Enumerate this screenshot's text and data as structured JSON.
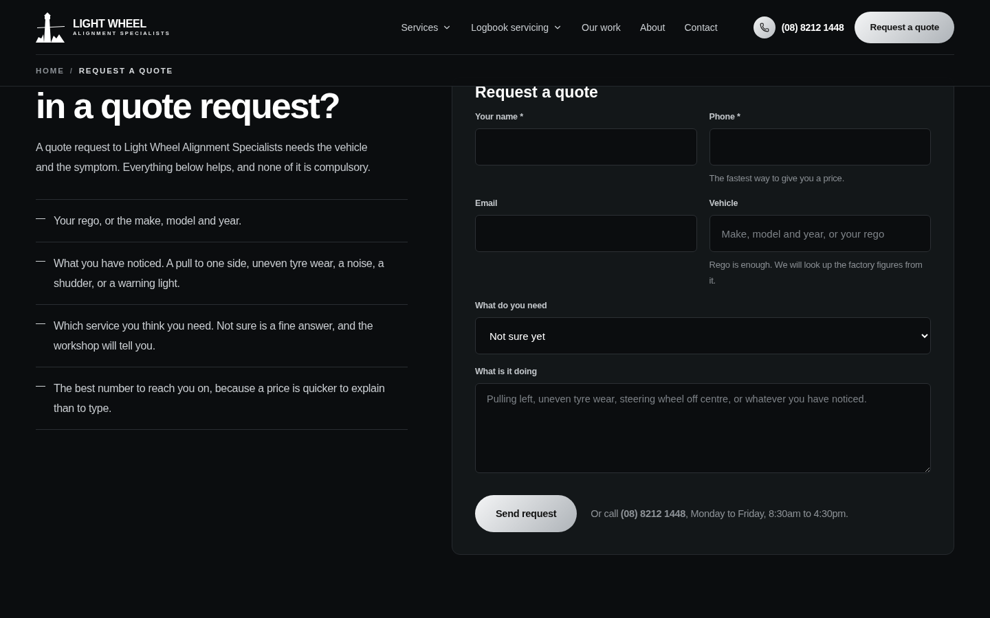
{
  "header": {
    "brand": "LIGHT WHEEL",
    "tagline": "ALIGNMENT SPECIALISTS",
    "nav": [
      {
        "label": "Services",
        "dropdown": true
      },
      {
        "label": "Logbook servicing",
        "dropdown": true
      },
      {
        "label": "Our work",
        "dropdown": false
      },
      {
        "label": "About",
        "dropdown": false
      },
      {
        "label": "Contact",
        "dropdown": false
      }
    ],
    "phone": "(08) 8212 1448",
    "cta": "Request a quote"
  },
  "breadcrumb": [
    {
      "label": "HOME",
      "current": false
    },
    {
      "label": "REQUEST A QUOTE",
      "current": true
    }
  ],
  "breadcrumb_separator": "/",
  "intro": {
    "heading": "in a quote request?",
    "paragraph": "A quote request to Light Wheel Alignment Specialists needs the vehicle and the symptom. Everything below helps, and none of it is compulsory.",
    "points": [
      "Your rego, or the make, model and year.",
      "What you have noticed. A pull to one side, uneven tyre wear, a noise, a shudder, or a warning light.",
      "Which service you think you need. Not sure is a fine answer, and the workshop will tell you.",
      "The best number to reach you on, because a price is quicker to explain than to type."
    ]
  },
  "form": {
    "title": "Request a quote",
    "fields": [
      {
        "kind": "input",
        "label": "Your name *"
      },
      {
        "kind": "input",
        "label": "Phone *",
        "hint": "The fastest way to give you a price."
      },
      {
        "kind": "input",
        "label": "Email"
      },
      {
        "kind": "input",
        "label": "Vehicle",
        "placeholder": "Make, model and year, or your rego",
        "hint": "Rego is enough. We will look up the factory figures from it."
      },
      {
        "kind": "select",
        "label": "What do you need",
        "value": "Not sure yet"
      },
      {
        "kind": "textarea",
        "label": "What is it doing",
        "placeholder": "Pulling left, uneven tyre wear, steering wheel off centre, or whatever you have noticed."
      }
    ],
    "submit": "Send request",
    "note": "Or call **(08) 8212 1448**, Monday to Friday, 8:30am to 4:30pm."
  }
}
